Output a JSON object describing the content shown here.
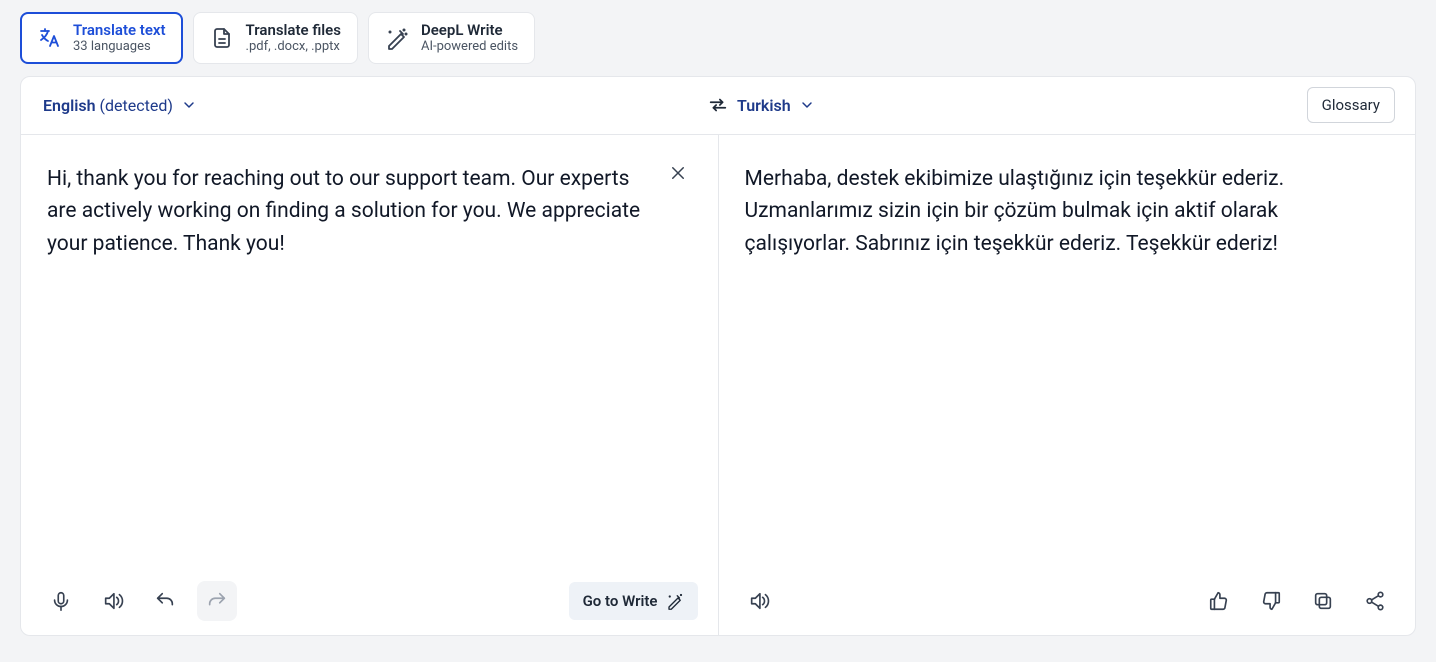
{
  "tabs": [
    {
      "title": "Translate text",
      "sub": "33 languages"
    },
    {
      "title": "Translate files",
      "sub": ".pdf, .docx, .pptx"
    },
    {
      "title": "DeepL Write",
      "sub": "AI-powered edits"
    }
  ],
  "source": {
    "lang": "English",
    "detected": "(detected)",
    "text": "Hi, thank you for reaching out to our support team. Our experts are actively working on finding a solution for you. We appreciate your patience. Thank you!"
  },
  "target": {
    "lang": "Turkish",
    "text": "Merhaba, destek ekibimize ulaştığınız için teşekkür ederiz. Uzmanlarımız sizin için bir çözüm bulmak için aktif olarak çalışıyorlar. Sabrınız için teşekkür ederiz. Teşekkür ederiz!"
  },
  "buttons": {
    "glossary": "Glossary",
    "go_to_write": "Go to Write"
  }
}
